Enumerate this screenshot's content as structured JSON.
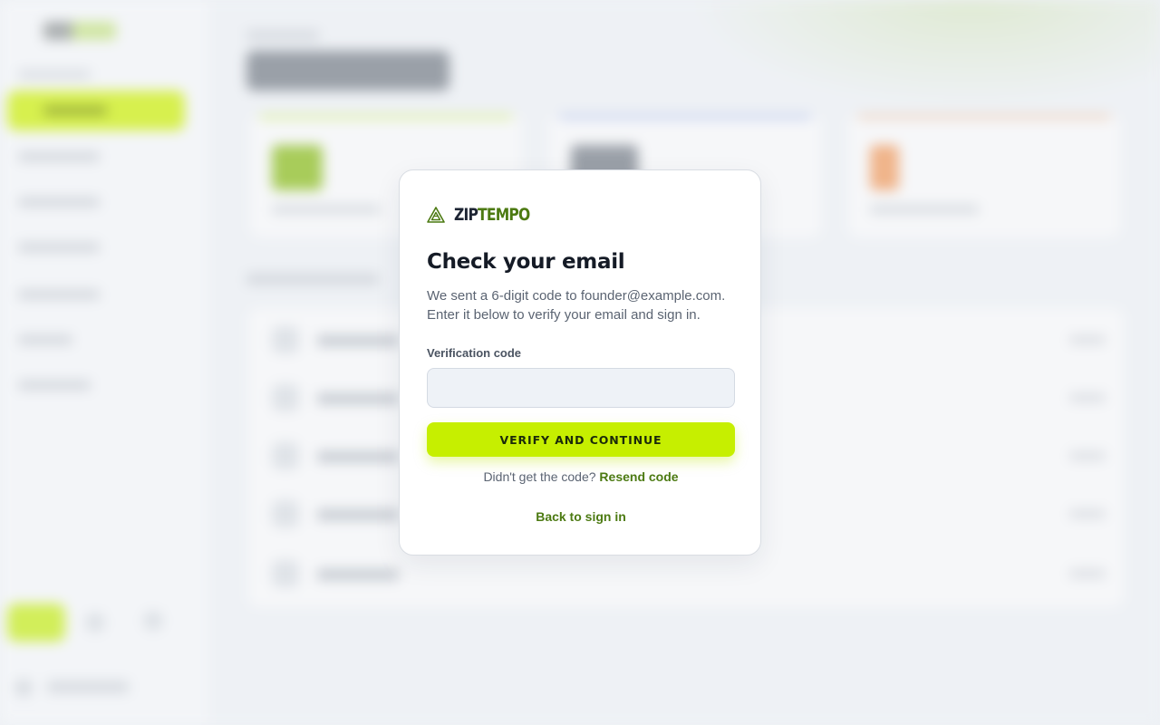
{
  "brand": {
    "name_part1": "ZIP",
    "name_part2": "TEMPO",
    "accent_color": "#4c7a12",
    "icon": "triangle-logo-icon"
  },
  "modal": {
    "title": "Check your email",
    "description_line1": "We sent a 6-digit code to founder@example.com.",
    "description_line2": "Enter it below to verify your email and sign in.",
    "code_label": "Verification code",
    "code_value": "",
    "code_placeholder": "",
    "verify_button": "VERIFY AND CONTINUE",
    "resend_prompt": "Didn't get the code?",
    "resend_link": "Resend code",
    "back_link": "Back to sign in"
  },
  "colors": {
    "primary_button": "#c6ef00",
    "input_bg": "#eef2f7",
    "backdrop": "#eef1f5"
  }
}
